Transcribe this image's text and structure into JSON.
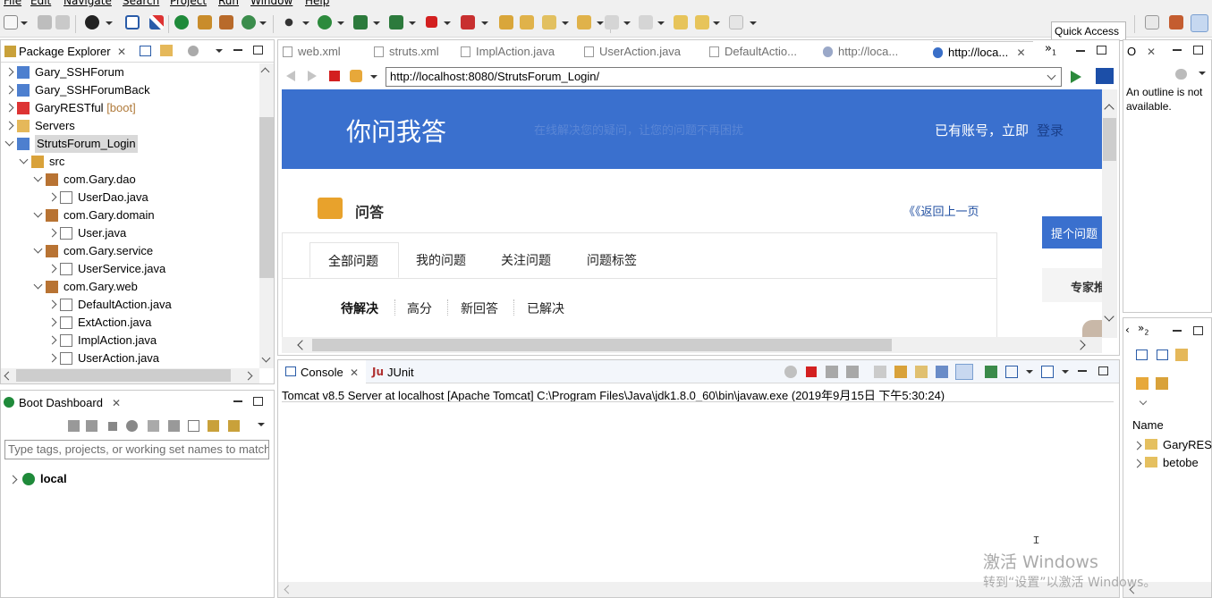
{
  "menu": {
    "items": [
      "File",
      "Edit",
      "Navigate",
      "Search",
      "Project",
      "Run",
      "Window",
      "Help"
    ]
  },
  "toolbar": {
    "quick_access": "Quick Access"
  },
  "package_explorer": {
    "title": "Package Explorer",
    "tree": [
      {
        "label": "Gary_SSHForum",
        "suffix": "",
        "depth": 0,
        "icon": "project-icon",
        "twisty": "closed"
      },
      {
        "label": "Gary_SSHForumBack",
        "suffix": "",
        "depth": 0,
        "icon": "project-icon",
        "twisty": "closed"
      },
      {
        "label": "GaryRESTful",
        "suffix": " [boot]",
        "depth": 0,
        "icon": "boot-project-icon",
        "twisty": "closed"
      },
      {
        "label": "Servers",
        "suffix": "",
        "depth": 0,
        "icon": "folder-icon",
        "twisty": "closed"
      },
      {
        "label": "StrutsForum_Login",
        "suffix": "",
        "depth": 0,
        "icon": "project-icon",
        "twisty": "open"
      },
      {
        "label": "src",
        "suffix": "",
        "depth": 1,
        "icon": "source-folder-icon",
        "twisty": "open"
      },
      {
        "label": "com.Gary.dao",
        "suffix": "",
        "depth": 2,
        "icon": "package-icon",
        "twisty": "open"
      },
      {
        "label": "UserDao.java",
        "suffix": "",
        "depth": 3,
        "icon": "java-file-icon",
        "twisty": "closed"
      },
      {
        "label": "com.Gary.domain",
        "suffix": "",
        "depth": 2,
        "icon": "package-icon",
        "twisty": "open"
      },
      {
        "label": "User.java",
        "suffix": "",
        "depth": 3,
        "icon": "java-file-icon",
        "twisty": "closed"
      },
      {
        "label": "com.Gary.service",
        "suffix": "",
        "depth": 2,
        "icon": "package-icon",
        "twisty": "open"
      },
      {
        "label": "UserService.java",
        "suffix": "",
        "depth": 3,
        "icon": "java-file-icon",
        "twisty": "closed"
      },
      {
        "label": "com.Gary.web",
        "suffix": "",
        "depth": 2,
        "icon": "package-icon",
        "twisty": "open"
      },
      {
        "label": "DefaultAction.java",
        "suffix": "",
        "depth": 3,
        "icon": "java-file-icon",
        "twisty": "closed"
      },
      {
        "label": "ExtAction.java",
        "suffix": "",
        "depth": 3,
        "icon": "java-file-icon",
        "twisty": "closed"
      },
      {
        "label": "ImplAction.java",
        "suffix": "",
        "depth": 3,
        "icon": "java-file-icon",
        "twisty": "closed"
      },
      {
        "label": "UserAction.java",
        "suffix": "",
        "depth": 3,
        "icon": "java-file-icon",
        "twisty": "closed"
      }
    ]
  },
  "boot_dashboard": {
    "title": "Boot Dashboard",
    "filter_placeholder": "Type tags, projects, or working set names to match",
    "items": [
      {
        "label": "local"
      }
    ]
  },
  "editor": {
    "tabs": [
      {
        "label": "web.xml",
        "icon": "xml-file-icon"
      },
      {
        "label": "struts.xml",
        "icon": "xml-file-icon"
      },
      {
        "label": "ImplAction.java",
        "icon": "java-file-icon"
      },
      {
        "label": "UserAction.java",
        "icon": "java-file-icon"
      },
      {
        "label": "DefaultActio...",
        "icon": "java-file-icon"
      },
      {
        "label": "http://loca...",
        "icon": "globe-icon"
      },
      {
        "label": "http://loca...",
        "icon": "globe-icon"
      }
    ],
    "overflow_count": "1",
    "browser_url": "http://localhost:8080/StrutsForum_Login/"
  },
  "webpage": {
    "site_title": "你问我答",
    "header_faded": "在线解决您的疑问，让您的问题不再困扰",
    "account_text": "已有账号，立即",
    "login_link": "登录",
    "section_title": "问答",
    "back_link": "《《返回上一页",
    "ask_button": "提个问题",
    "expert_label": "专家推",
    "tabs": [
      "全部问题",
      "我的问题",
      "关注问题",
      "问题标签"
    ],
    "filters": [
      "待解决",
      "高分",
      "新回答",
      "已解决"
    ]
  },
  "console": {
    "tabs": [
      "Console",
      "JUnit"
    ],
    "status_line": "Tomcat v8.5 Server at localhost [Apache Tomcat] C:\\Program Files\\Java\\jdk1.8.0_60\\bin\\javaw.exe (2019年9月15日 下午5:30:24)"
  },
  "outline": {
    "tab": "O",
    "message": "An outline is not available."
  },
  "types_view": {
    "header": "Name",
    "items": [
      "GaryRESTful",
      "betobe"
    ],
    "overflow_count": "2"
  },
  "watermark": {
    "line1": "激活 Windows",
    "line2": "转到“设置”以激活 Windows。"
  },
  "colors": {
    "header_blue": "#3a70ce",
    "link_blue": "#2c5fb8",
    "ask_button": "#3a70ce"
  }
}
